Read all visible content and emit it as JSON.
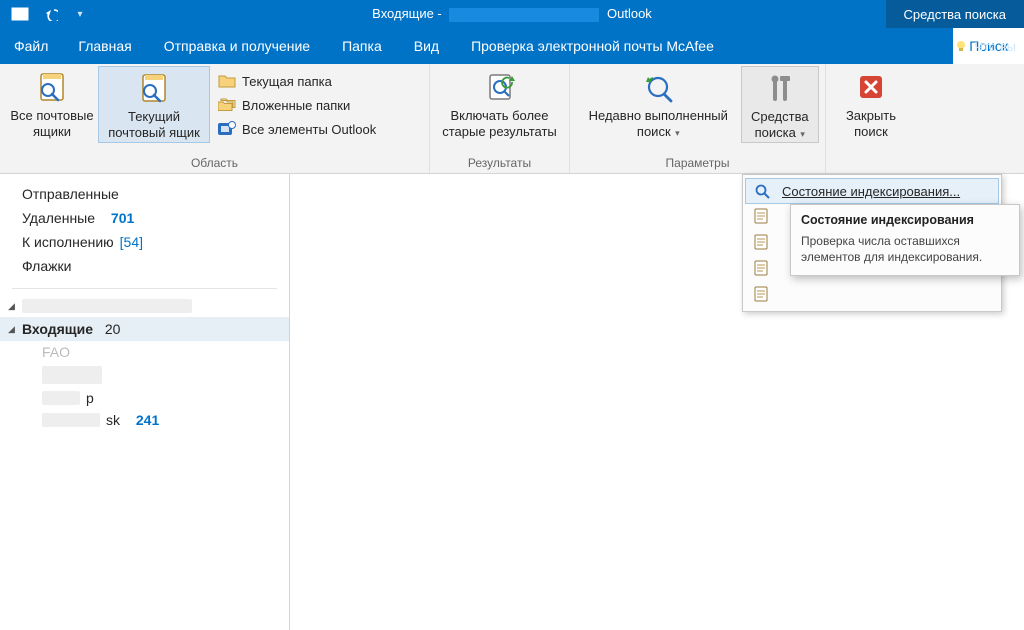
{
  "colors": {
    "accent": "#0173c7",
    "accent_dark": "#065b9b"
  },
  "titlebar": {
    "title_prefix": "Входящие -",
    "title_suffix": "Outlook",
    "search_tools": "Средства поиска"
  },
  "tabs": {
    "file": "Файл",
    "home": "Главная",
    "sendreceive": "Отправка и получение",
    "folder": "Папка",
    "view": "Вид",
    "mcafee": "Проверка электронной почты McAfee",
    "search": "Поиск",
    "tell_me": "Что вы"
  },
  "ribbon": {
    "scope": {
      "label": "Область",
      "all_mailboxes": "Все почтовые\nящики",
      "current_mailbox": "Текущий\nпочтовый ящик",
      "current_folder": "Текущая папка",
      "subfolders": "Вложенные папки",
      "all_outlook": "Все элементы Outlook"
    },
    "results": {
      "label": "Результаты",
      "include_older": "Включать более\nстарые результаты"
    },
    "options": {
      "label": "Параметры",
      "recent_search": "Недавно выполненный\nпоиск",
      "search_tools": "Средства\nпоиска"
    },
    "close": {
      "close_search": "Закрыть\nпоиск"
    }
  },
  "dropdown": {
    "indexing_status": "Состояние индексирования...",
    "item2": " ",
    "item3": " ",
    "item4": " ",
    "item5": " "
  },
  "tooltip": {
    "title": "Состояние индексирования",
    "body": "Проверка числа оставшихся элементов для индексирования."
  },
  "nav": {
    "sent": "Отправленные",
    "deleted": "Удаленные",
    "deleted_count": "701",
    "followup": "К исполнению",
    "followup_count": "[54]",
    "flags": "Флажки",
    "inbox": "Входящие",
    "inbox_count": "20",
    "sub_p": "p",
    "sub_sk": "sk",
    "sub_sk_count": "241"
  }
}
